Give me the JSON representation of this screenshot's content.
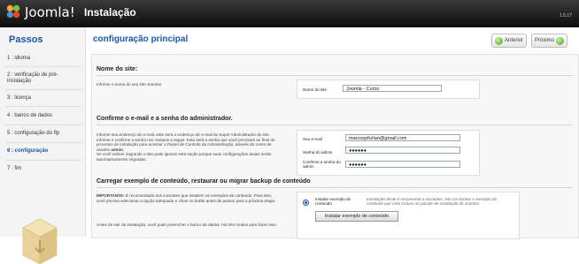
{
  "header": {
    "brand": "Joomla!",
    "title": "Instalação",
    "version": "1.5.17"
  },
  "sidebar": {
    "title": "Passos",
    "steps": [
      "1 : idioma",
      "2 : verificação de pré-instalação",
      "3 : licença",
      "4 : banco de dados",
      "5 : configuração do ftp",
      "6 : configuração",
      "7 : fim"
    ]
  },
  "main": {
    "title": "configuração principal",
    "prev_label": "Anterior",
    "next_label": "Próximo"
  },
  "site": {
    "heading": "Nome do site:",
    "description": "Informe o nome do seu site Joomla!",
    "label": "Nome do site",
    "value": "Joomla - Curso"
  },
  "admin": {
    "heading": "Confirme o e-mail e a senha do administrador.",
    "description_1": "Informe seu endereço de e-mail, este será o endereço de e-mail do Super Administrador do site.",
    "description_2": "Informe e confirme a senha nos campos a seguir. Esta será a senha que você precisará ao final do processo de instalação para acessar o Painel de Controle da Administração, através do nome de usuário",
    "description_user": "admin",
    "description_3": "Se você estiver migrando o site pode ignorar esta seção porque suas configurações atuais serão automaticamente migradas.",
    "email_label": "Seu e-mail",
    "email_value": "marcospfurlan@gmail.com",
    "pass_label": "Senha do admin",
    "pass_value": "●●●●●●",
    "confirm_label": "Confirme a senha do admin",
    "confirm_value": "●●●●●●"
  },
  "sample": {
    "heading": "Carregar exemplo de conteúdo, restaurar ou migrar backup de conteúdo",
    "important_bold": "IMPORTANTE:",
    "important_text": "É recomendado aos iniciantes que instalem os exemplos de conteúdo. Para isso, você precisa selecionar a opção adequada e clicar no botão antes de passar para a próxima etapa.",
    "before_text": "Antes de sair da instalação, você pode preencher o banco de dados. Há três modos para fazer isso:",
    "radio_label": "Instalar exemplo de conteúdo",
    "radio_note": "Instalação deste é recomenda a iniciantes. Isto irá instalar o exemplo de conteúdo que está incluso no pacote de instalação do Joomla!.",
    "button_label": "Instalar exemplo de conteúdo"
  }
}
